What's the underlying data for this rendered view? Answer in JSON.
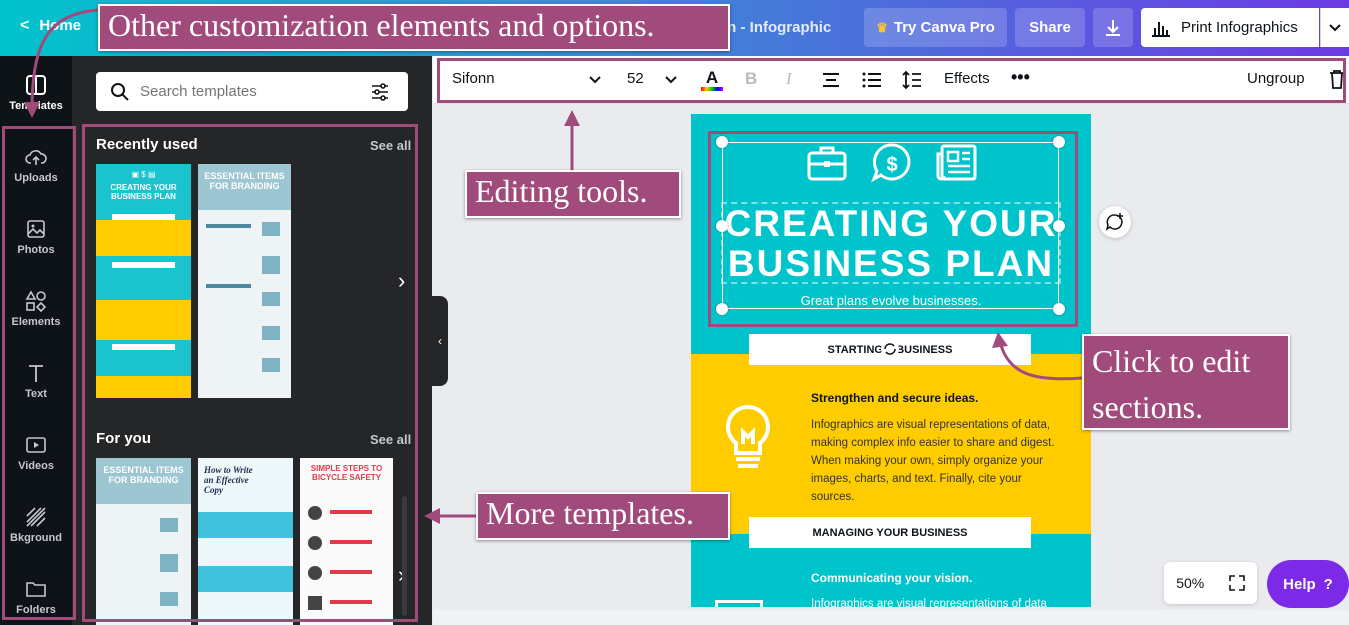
{
  "topbar": {
    "home_label": "Home",
    "doc_title": "gn - Infographic",
    "pro_label": "Try Canva Pro",
    "share_label": "Share",
    "print_label": "Print Infographics"
  },
  "rail": {
    "items": [
      {
        "label": "Templates",
        "icon": "templates-icon"
      },
      {
        "label": "Uploads",
        "icon": "cloud-upload-icon"
      },
      {
        "label": "Photos",
        "icon": "image-icon"
      },
      {
        "label": "Elements",
        "icon": "shapes-icon"
      },
      {
        "label": "Text",
        "icon": "text-icon"
      },
      {
        "label": "Videos",
        "icon": "video-icon"
      },
      {
        "label": "Bkground",
        "icon": "background-icon"
      },
      {
        "label": "Folders",
        "icon": "folder-icon"
      }
    ]
  },
  "panel": {
    "search_placeholder": "Search templates",
    "recent_title": "Recently used",
    "recent_see_all": "See all",
    "foryou_title": "For you",
    "foryou_see_all": "See all",
    "templates": {
      "recent1": {
        "title": "CREATING YOUR BUSINESS PLAN"
      },
      "recent2": {
        "title": "ESSENTIAL ITEMS FOR BRANDING"
      },
      "foryou1": {
        "title": "ESSENTIAL ITEMS FOR BRANDING"
      },
      "foryou2": {
        "title": "How to Write an Effective Copy"
      },
      "foryou3": {
        "title": "SIMPLE STEPS TO BICYCLE SAFETY"
      }
    }
  },
  "toolbar": {
    "font_name": "Sifonn",
    "font_size": "52",
    "effects_label": "Effects",
    "ungroup_label": "Ungroup"
  },
  "design": {
    "title_line1": "CREATING YOUR",
    "title_line2": "BUSINESS PLAN",
    "subtitle": "Great plans evolve businesses.",
    "section1_label": "STARTING A BUSINESS",
    "section1_heading": "Strengthen and secure ideas.",
    "section1_body": "Infographics are visual representations of data, making complex info easier to share and digest. When making your own, simply organize your images, charts, and text. Finally, cite your sources.",
    "section2_label": "MANAGING YOUR BUSINESS",
    "section2_heading": "Communicating your vision.",
    "section2_body": "Infographics are visual representations of data"
  },
  "zoom": {
    "level": "50%"
  },
  "help": {
    "label": "Help",
    "symbol": "?"
  },
  "annotations": {
    "other_options": "Other customization elements and options.",
    "editing_tools": "Editing tools.",
    "click_edit": "Click to edit sections.",
    "more_templates": "More templates."
  },
  "colors": {
    "accent_purple": "#7d2ae8",
    "annotation": "#a14b7c",
    "design_teal": "#00c4cc",
    "design_yellow": "#ffcc00"
  }
}
